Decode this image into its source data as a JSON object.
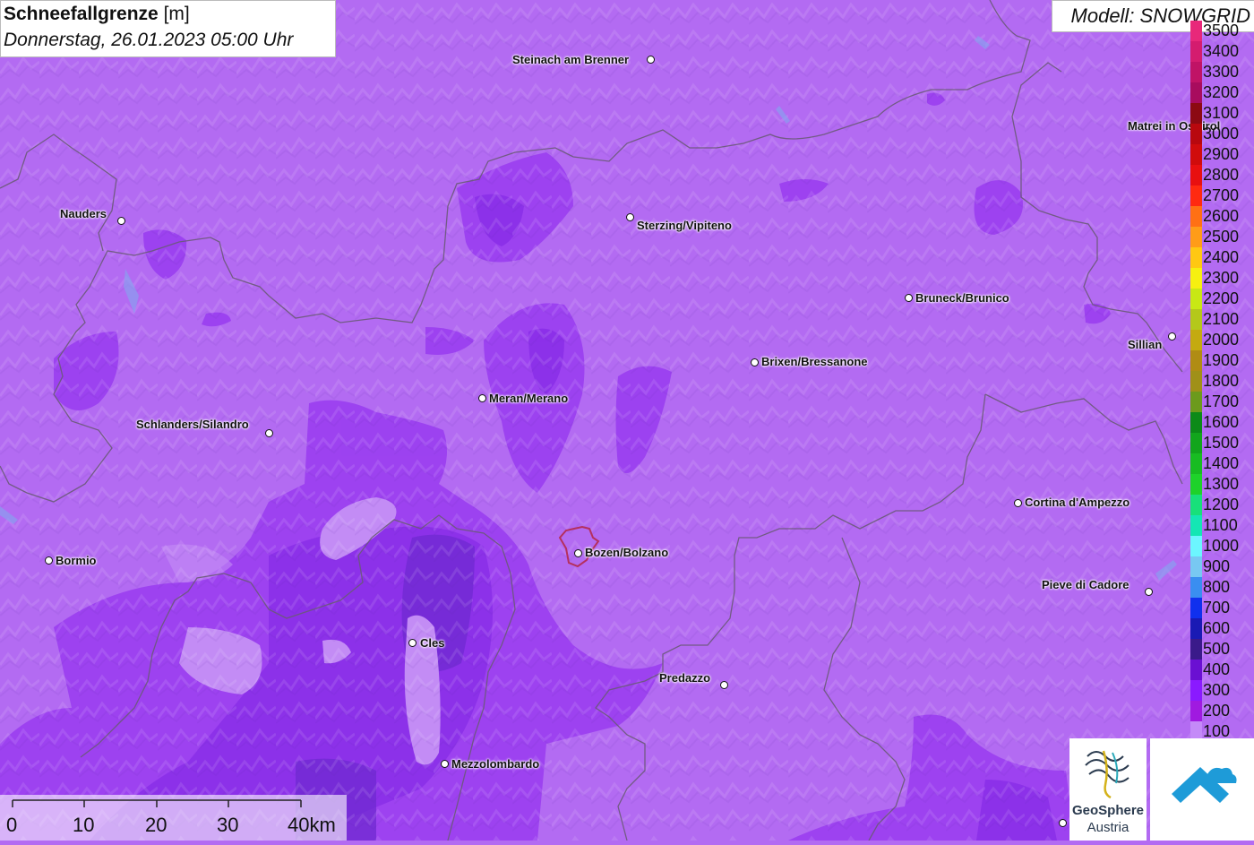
{
  "title": {
    "name": "Schneefallgrenze",
    "unit": "[m]",
    "datetime": "Donnerstag, 26.01.2023 05:00 Uhr"
  },
  "model": "Modell: SNOWGRID",
  "legend": [
    {
      "value": "3500",
      "color": "#e8287a"
    },
    {
      "value": "3400",
      "color": "#d41c6f"
    },
    {
      "value": "3300",
      "color": "#c01366"
    },
    {
      "value": "3200",
      "color": "#a80c5e"
    },
    {
      "value": "3100",
      "color": "#8c0a12"
    },
    {
      "value": "3000",
      "color": "#b8080e"
    },
    {
      "value": "2900",
      "color": "#d00c0c"
    },
    {
      "value": "2800",
      "color": "#e81010"
    },
    {
      "value": "2700",
      "color": "#ff2a10"
    },
    {
      "value": "2600",
      "color": "#ff7014"
    },
    {
      "value": "2500",
      "color": "#ff9c18"
    },
    {
      "value": "2400",
      "color": "#ffc812"
    },
    {
      "value": "2300",
      "color": "#f6f010"
    },
    {
      "value": "2200",
      "color": "#c8e814"
    },
    {
      "value": "2100",
      "color": "#b4c81a"
    },
    {
      "value": "2000",
      "color": "#c4aa10"
    },
    {
      "value": "1900",
      "color": "#b08c14"
    },
    {
      "value": "1800",
      "color": "#a09018"
    },
    {
      "value": "1700",
      "color": "#6c9a1c"
    },
    {
      "value": "1600",
      "color": "#0c8a18"
    },
    {
      "value": "1500",
      "color": "#12a51c"
    },
    {
      "value": "1400",
      "color": "#18bc22"
    },
    {
      "value": "1300",
      "color": "#1ed22a"
    },
    {
      "value": "1200",
      "color": "#18e07a"
    },
    {
      "value": "1100",
      "color": "#14e6b4"
    },
    {
      "value": "1000",
      "color": "#6cf6ff"
    },
    {
      "value": "900",
      "color": "#78c8f2"
    },
    {
      "value": "800",
      "color": "#3a8ef0"
    },
    {
      "value": "700",
      "color": "#1030ee"
    },
    {
      "value": "600",
      "color": "#1a1ab4"
    },
    {
      "value": "500",
      "color": "#3a1a8a"
    },
    {
      "value": "400",
      "color": "#6a10d2"
    },
    {
      "value": "300",
      "color": "#8a1aff"
    },
    {
      "value": "200",
      "color": "#a01ae0"
    },
    {
      "value": "100",
      "color": "#c48af8"
    }
  ],
  "places": [
    {
      "name": "Steinach am Brenner"
    },
    {
      "name": "Nauders"
    },
    {
      "name": "Sterzing/Vipiteno"
    },
    {
      "name": "Matrei in Osttirol"
    },
    {
      "name": "Bruneck/Brunico"
    },
    {
      "name": "Sillian"
    },
    {
      "name": "Brixen/Bressanone"
    },
    {
      "name": "Meran/Merano"
    },
    {
      "name": "Schlanders/Silandro"
    },
    {
      "name": "Cortina d'Ampezzo"
    },
    {
      "name": "Bormio"
    },
    {
      "name": "Bozen/Bolzano"
    },
    {
      "name": "Pieve di Cadore"
    },
    {
      "name": "Cles"
    },
    {
      "name": "Predazzo"
    },
    {
      "name": "Mezzolombardo"
    }
  ],
  "scalebar": {
    "labels": [
      "0",
      "10",
      "20",
      "30",
      "40km"
    ]
  },
  "logos": {
    "geosphere_name": "GeoSphere",
    "geosphere_sub": "Austria"
  },
  "colors": {
    "base": "#b36bf2",
    "dark": "#9a3ef0",
    "darker": "#8a30e8",
    "light": "#c38cf5",
    "border": "#6a5a78"
  }
}
